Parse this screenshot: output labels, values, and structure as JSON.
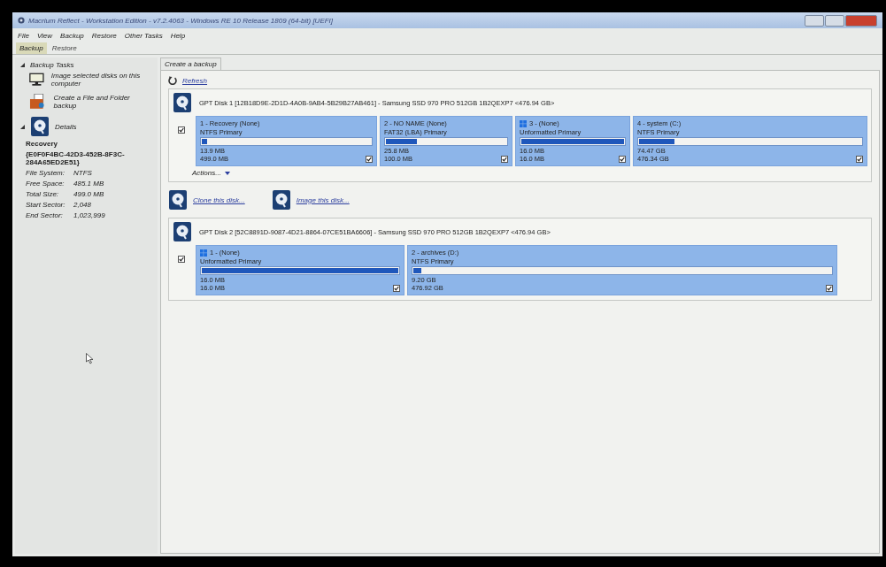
{
  "window": {
    "title": "Macrium Reflect - Workstation Edition - v7.2.4063 - Windows RE 10 Release 1809 (64-bit)  [UEFI]"
  },
  "menu": [
    "File",
    "View",
    "Backup",
    "Restore",
    "Other Tasks",
    "Help"
  ],
  "tabs": [
    {
      "label": "Backup",
      "selected": true
    },
    {
      "label": "Restore",
      "selected": false
    }
  ],
  "sidebar": {
    "tasks_heading": "Backup Tasks",
    "tasks": [
      "Image selected disks on this computer",
      "Create a File and Folder backup"
    ],
    "details_heading": "Details",
    "details_name": "Recovery",
    "details_id": "{E0F0F4BC-42D3-452B-8F3C-284A65ED2E51}",
    "details": [
      {
        "label": "File System:",
        "value": "NTFS"
      },
      {
        "label": "Free Space:",
        "value": "485.1 MB"
      },
      {
        "label": "Total Size:",
        "value": "499.0 MB"
      },
      {
        "label": "Start Sector:",
        "value": "2,048"
      },
      {
        "label": "End Sector:",
        "value": "1,023,999"
      }
    ]
  },
  "content": {
    "tab": "Create a backup",
    "refresh": "Refresh",
    "actions": "Actions...",
    "clone_link": "Clone this disk...",
    "image_link": "Image this disk...",
    "disks": [
      {
        "title": "GPT Disk 1 [12B18D9E-2D1D-4A0B-9AB4-5B29B27AB461] - Samsung SSD 970 PRO 512GB 1B2QEXP7  <476.94 GB>",
        "checked": true,
        "partitions": [
          {
            "kind": "plain",
            "name": "1 - Recovery (None)",
            "type": "NTFS Primary",
            "level": 0.03,
            "used": "13.9 MB",
            "total": "499.0 MB",
            "checked": true
          },
          {
            "kind": "plain",
            "name": "2 - NO NAME (None)",
            "type": "FAT32 (LBA) Primary",
            "level": 0.26,
            "used": "25.8 MB",
            "total": "100.0 MB",
            "checked": true
          },
          {
            "kind": "logo",
            "name": "3 - (None)",
            "type": "Unformatted Primary",
            "level": 1,
            "used": "16.0 MB",
            "total": "16.0 MB",
            "checked": true
          },
          {
            "kind": "plain",
            "name": "4 - system (C:)",
            "type": "NTFS Primary",
            "level": 0.16,
            "used": "74.47 GB",
            "total": "476.34 GB",
            "checked": true
          }
        ]
      },
      {
        "title": "GPT Disk 2 [52C8891D-9087-4D21-8864-07CE51BA6606] - Samsung SSD 970 PRO 512GB 1B2QEXP7  <476.94 GB>",
        "checked": true,
        "partitions": [
          {
            "kind": "logo",
            "name": "1 - (None)",
            "type": "Unformatted Primary",
            "level": 1,
            "used": "16.0 MB",
            "total": "16.0 MB",
            "checked": true
          },
          {
            "kind": "plain",
            "name": "2 - archives (D:)",
            "type": "NTFS Primary",
            "level": 0.02,
            "used": "9.20 GB",
            "total": "476.92 GB",
            "checked": true
          }
        ]
      }
    ]
  }
}
